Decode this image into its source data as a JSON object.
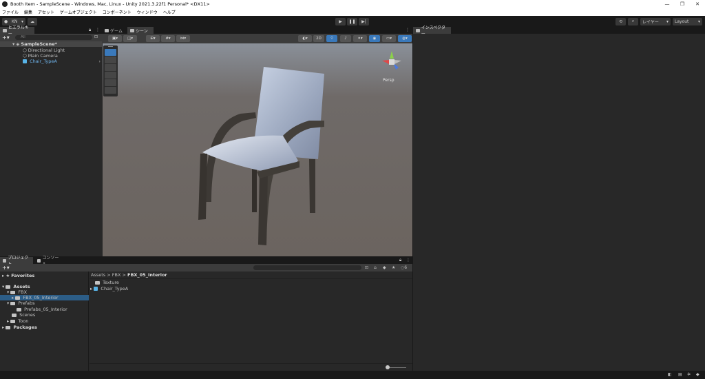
{
  "window": {
    "title": "Booth Item - SampleScene - Windows, Mac, Linux - Unity 2021.3.22f1 Personal* <DX11>",
    "min": "—",
    "max": "❐",
    "close": "✕"
  },
  "menu": [
    "ファイル",
    "編集",
    "アセット",
    "ゲームオブジェクト",
    "コンポーネント",
    "ウィンドウ",
    "ヘルプ"
  ],
  "toolbar": {
    "account": "KN",
    "layers": "レイヤー",
    "layout": "Layout"
  },
  "hierarchy": {
    "tab": "ヒエラルキー",
    "search_placeholder": "All",
    "scene": "SampleScene*",
    "items": [
      "Directional Light",
      "Main Camera",
      "Chair_TypeA"
    ]
  },
  "scene_view": {
    "tab_game": "ゲーム",
    "tab_scene": "シーン",
    "mode_2d": "2D",
    "gizmo_label": "Persp"
  },
  "inspector": {
    "tab": "インスペクター"
  },
  "project": {
    "tab_project": "プロジェクト",
    "tab_console": "コンソール",
    "badge": "6",
    "favorites": "Favorites",
    "assets": "Assets",
    "tree": [
      "FBX",
      "FBX_05_Interior",
      "Prefabs",
      "Prefabs_05_Interior",
      "Scenes",
      "Toon"
    ],
    "packages": "Packages",
    "breadcrumbs": [
      "Assets",
      "FBX",
      "FBX_05_Interior"
    ],
    "files": [
      "Texture",
      "Chair_TypeA"
    ]
  },
  "colors": {
    "accent": "#3a79bb",
    "selection": "#2c5d87",
    "panel": "#282828",
    "chair_seat": "#b6c1d6",
    "chair_frame": "#3a3632"
  }
}
